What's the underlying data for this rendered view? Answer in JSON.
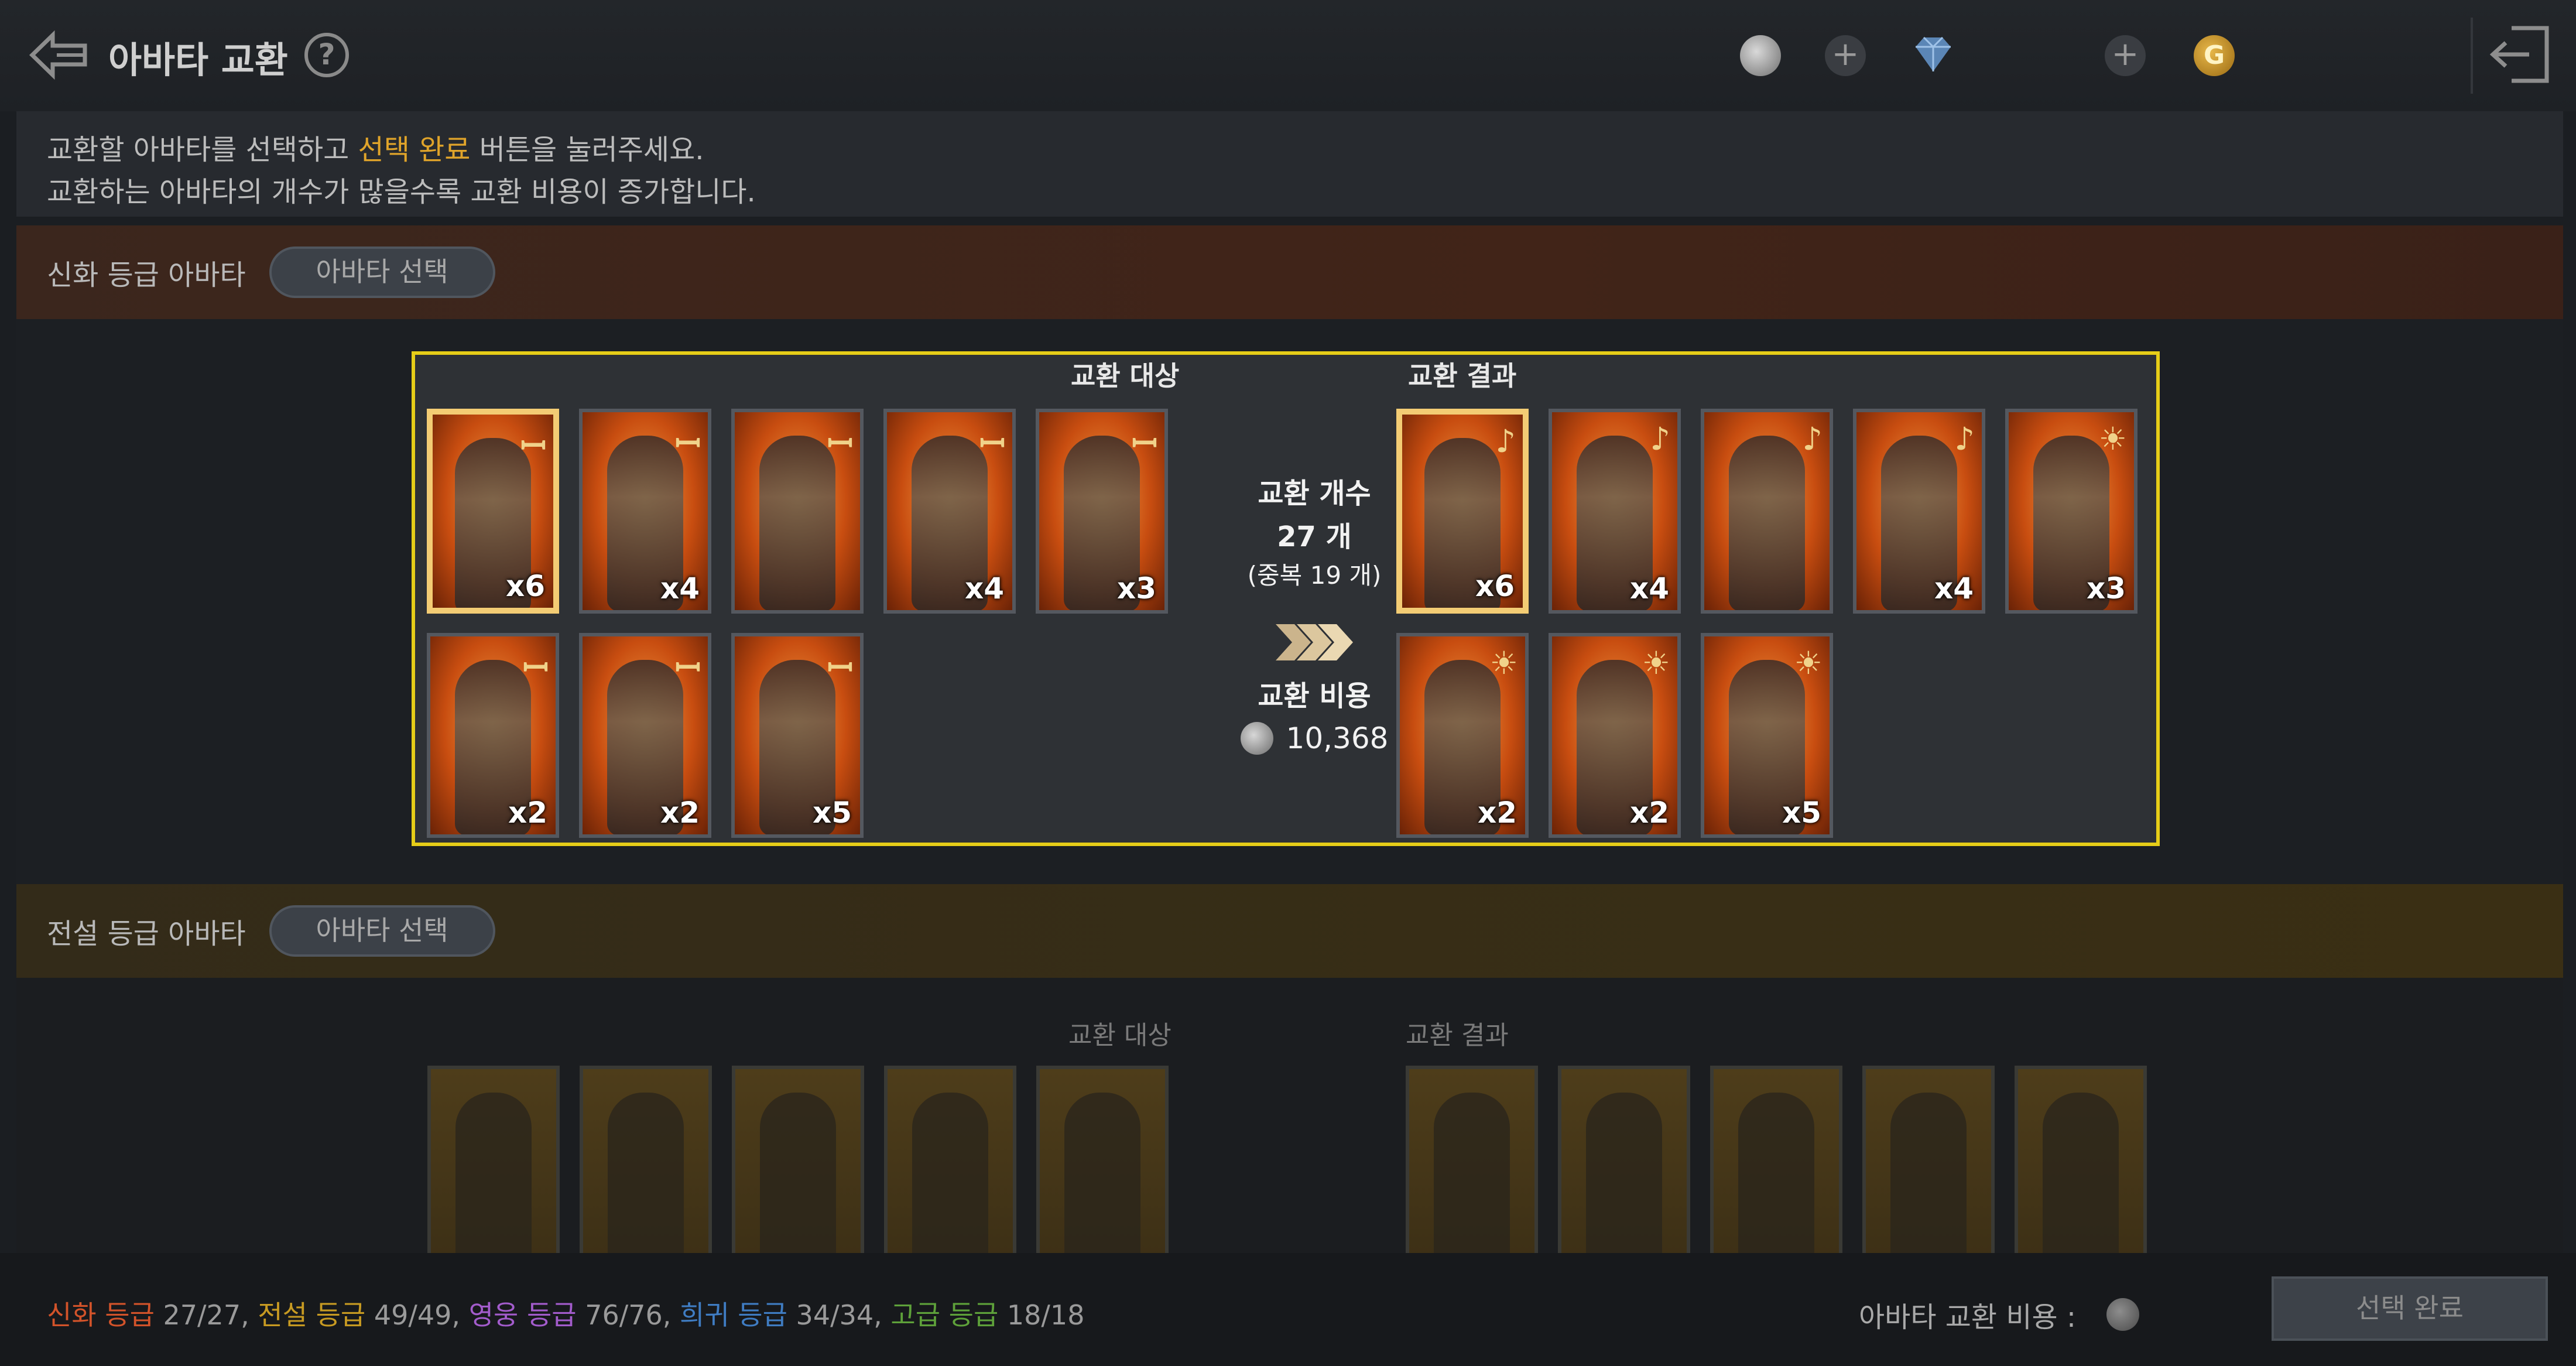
{
  "header": {
    "title": "아바타 교환",
    "help_symbol": "?",
    "plus_symbol": "+",
    "gold_symbol": "G",
    "icons": [
      "back-arrow-icon",
      "help-icon",
      "silver-coin-icon",
      "plus-icon",
      "diamond-icon",
      "plus-icon",
      "gold-icon",
      "exit-icon"
    ]
  },
  "info": {
    "line1_pre": "교환할 아바타를 선택하고 ",
    "line1_hl": "선택 완료",
    "line1_post": " 버튼을 눌러주세요.",
    "line2": "교환하는 아바타의 개수가 많을수록 교환 비용이 증가합니다.",
    "highlight_color": "#e0a42a"
  },
  "mythic_section": {
    "label": "신화 등급 아바타",
    "select_button": "아바타 선택",
    "target_title": "교환 대상",
    "result_title": "교환 결과",
    "target_cards": [
      {
        "count": "x6",
        "glyph": "ꟷ",
        "selected": true
      },
      {
        "count": "x4",
        "glyph": "ꟷ",
        "selected": false
      },
      {
        "count": "",
        "glyph": "ꟷ",
        "selected": false
      },
      {
        "count": "x4",
        "glyph": "ꟷ",
        "selected": false
      },
      {
        "count": "x3",
        "glyph": "ꟷ",
        "selected": false
      },
      {
        "count": "x2",
        "glyph": "ꟷ",
        "selected": false
      },
      {
        "count": "x2",
        "glyph": "ꟷ",
        "selected": false
      },
      {
        "count": "x5",
        "glyph": "ꟷ",
        "selected": false
      }
    ],
    "result_cards": [
      {
        "count": "x6",
        "glyph": "♪",
        "selected": true
      },
      {
        "count": "x4",
        "glyph": "♪",
        "selected": false
      },
      {
        "count": "",
        "glyph": "♪",
        "selected": false
      },
      {
        "count": "x4",
        "glyph": "♪",
        "selected": false
      },
      {
        "count": "x3",
        "glyph": "☀",
        "selected": false
      },
      {
        "count": "x2",
        "glyph": "☀",
        "selected": false
      },
      {
        "count": "x2",
        "glyph": "☀",
        "selected": false
      },
      {
        "count": "x5",
        "glyph": "☀",
        "selected": false
      }
    ],
    "exchange_count_label": "교환 개수",
    "exchange_count_value": "27 개",
    "exchange_dup": "(중복 19 개)",
    "exchange_cost_label": "교환 비용",
    "exchange_cost_value": "10,368"
  },
  "legend_section": {
    "label": "전설 등급 아바타",
    "select_button": "아바타 선택",
    "target_title": "교환 대상",
    "result_title": "교환 결과"
  },
  "bottom": {
    "mythic_label": "신화 등급",
    "mythic_count": " 27/27, ",
    "legend_label": "전설 등급",
    "legend_count": " 49/49, ",
    "hero_label": "영웅 등급",
    "hero_count": " 76/76, ",
    "rare_label": "희귀 등급",
    "rare_count": " 34/34, ",
    "adv_label": "고급 등급",
    "adv_count": " 18/18",
    "cost_label": "아바타 교환 비용 :",
    "done_button": "선택 완료"
  },
  "colors": {
    "mythic": "#d2532a",
    "legend": "#c79a22",
    "hero": "#a35ccc",
    "rare": "#3f7cc2",
    "advanced": "#5ea13a",
    "box_border": "#e6cd18"
  }
}
